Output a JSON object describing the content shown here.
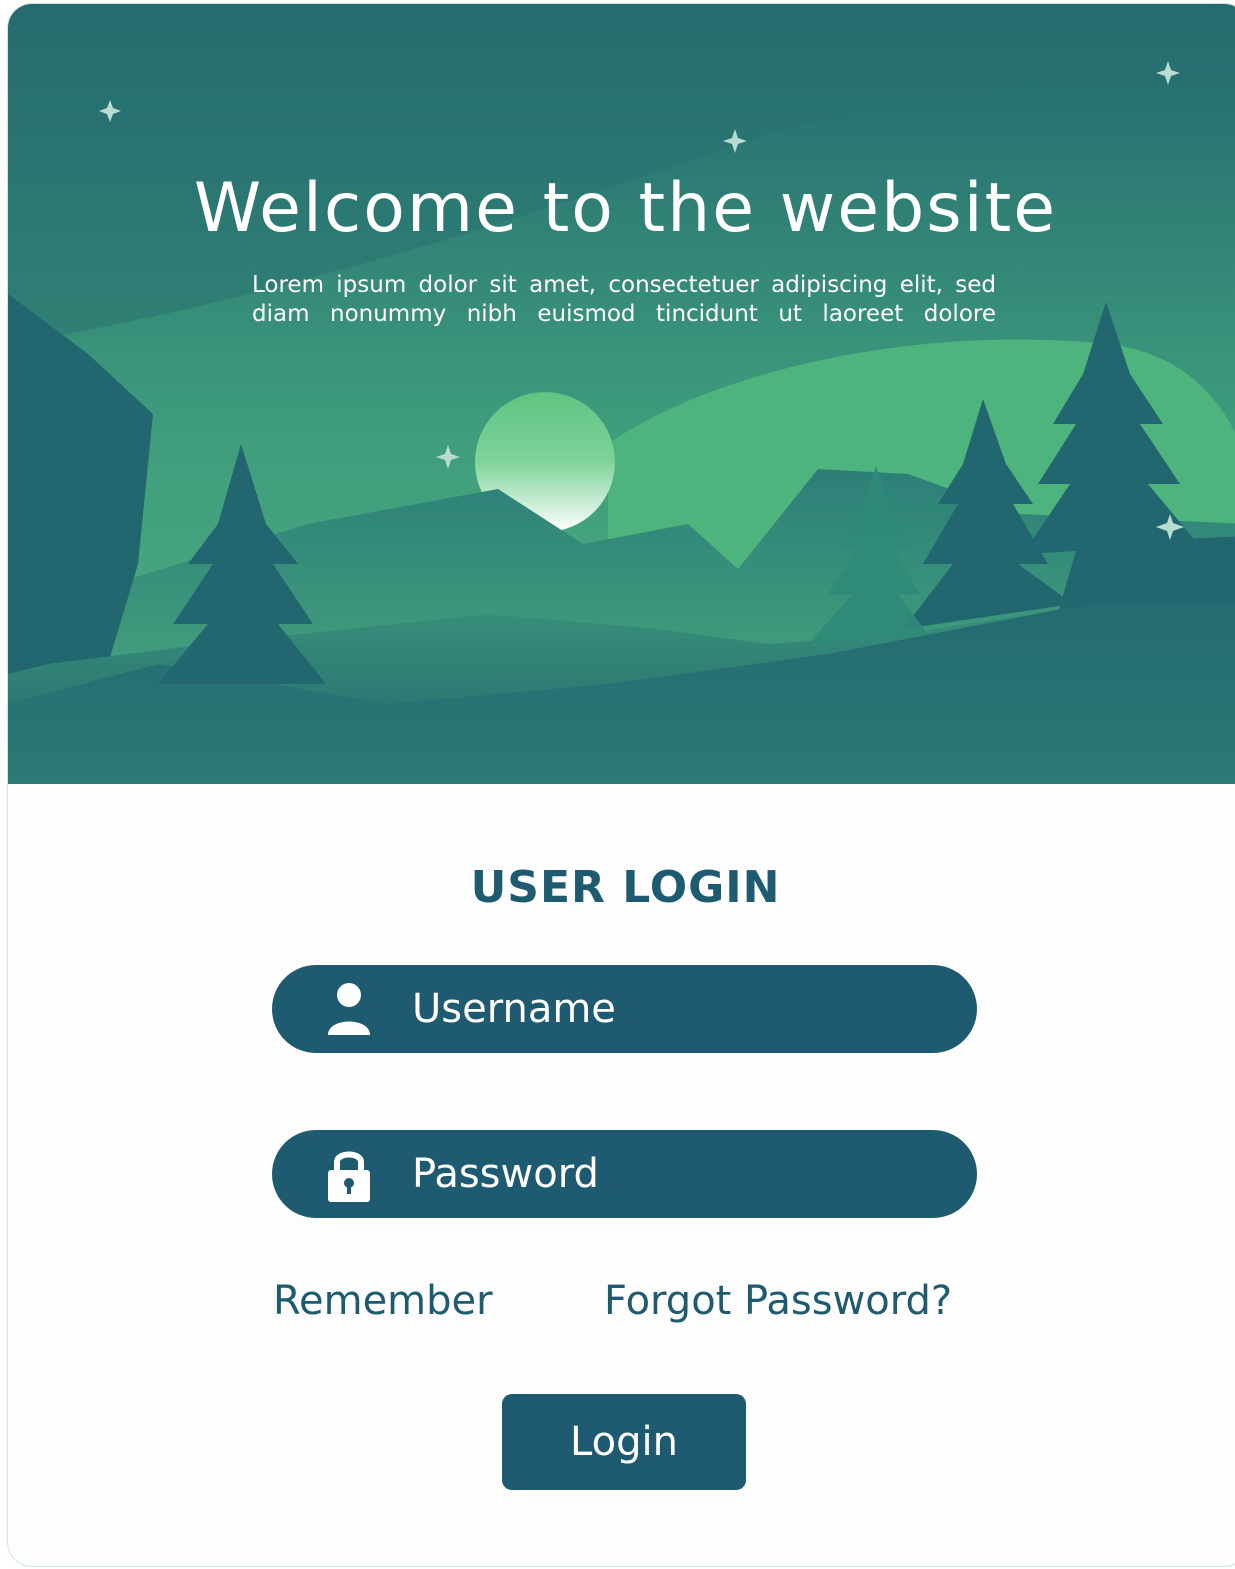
{
  "hero": {
    "title": "Welcome to the website",
    "subtitle": "Lorem ipsum dolor sit amet, consectetuer adipiscing elit, sed diam nonummy nibh euismod tincidunt ut laoreet dolore"
  },
  "login": {
    "title": "USER LOGIN",
    "username": {
      "placeholder": "Username",
      "value": "",
      "icon": "user-icon"
    },
    "password": {
      "placeholder": "Password",
      "value": "",
      "icon": "lock-icon"
    },
    "remember_label": "Remember",
    "forgot_label": "Forgot Password?",
    "submit_label": "Login"
  },
  "colors": {
    "primary": "#1e5b70",
    "hero_light": "#5fc482",
    "hero_dark": "#1f5f72",
    "text_light": "#ffffff"
  }
}
